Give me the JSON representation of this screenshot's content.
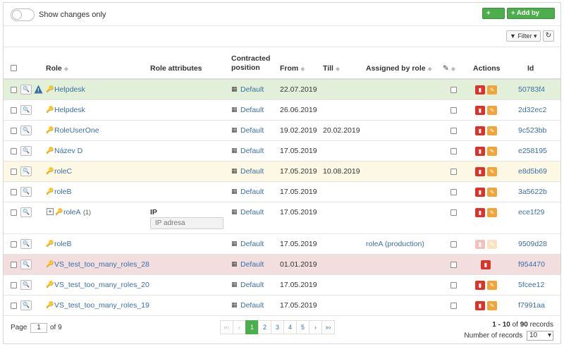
{
  "toolbar": {
    "show_changes_label": "Show changes only",
    "add_label": "+ Add",
    "add_by_user_label": "+ Add by user",
    "filter_label": "Filter",
    "refresh_icon": "↻"
  },
  "columns": {
    "role": "Role",
    "role_attributes": "Role attributes",
    "contracted_position_1": "Contracted",
    "contracted_position_2": "position",
    "from": "From",
    "till": "Till",
    "assigned_by_role": "Assigned by role",
    "actions": "Actions",
    "id": "Id"
  },
  "rows": [
    {
      "role": "Helpdesk",
      "position": "Default",
      "from": "22.07.2019",
      "till": "",
      "assigned_by": "",
      "id": "50783f4"
    },
    {
      "role": "Helpdesk",
      "position": "Default",
      "from": "26.06.2019",
      "till": "",
      "assigned_by": "",
      "id": "2d32ec2"
    },
    {
      "role": "RoleUserOne",
      "position": "Default",
      "from": "19.02.2019",
      "till": "20.02.2019",
      "assigned_by": "",
      "id": "9c523bb"
    },
    {
      "role": "Název D",
      "position": "Default",
      "from": "17.05.2019",
      "till": "",
      "assigned_by": "",
      "id": "e258195"
    },
    {
      "role": "roleC",
      "position": "Default",
      "from": "17.05.2019",
      "till": "10.08.2019",
      "assigned_by": "",
      "id": "e8d5b69"
    },
    {
      "role": "roleB",
      "position": "Default",
      "from": "17.05.2019",
      "till": "",
      "assigned_by": "",
      "id": "3a5622b"
    },
    {
      "role": "roleA",
      "role_count": "(1)",
      "attr_label": "IP",
      "attr_placeholder": "IP adresa",
      "position": "Default",
      "from": "17.05.2019",
      "till": "",
      "assigned_by": "",
      "id": "ece1f29"
    },
    {
      "role": "roleB",
      "position": "Default",
      "from": "17.05.2019",
      "till": "",
      "assigned_by": "roleA (production)",
      "id": "9509d28"
    },
    {
      "role": "VS_test_too_many_roles_28",
      "position": "Default",
      "from": "01.01.2019",
      "till": "",
      "assigned_by": "",
      "id": "f954470"
    },
    {
      "role": "VS_test_too_many_roles_20",
      "position": "Default",
      "from": "17.05.2019",
      "till": "",
      "assigned_by": "",
      "id": "5fcee12"
    },
    {
      "role": "VS_test_too_many_roles_19",
      "position": "Default",
      "from": "17.05.2019",
      "till": "",
      "assigned_by": "",
      "id": "f7991aa"
    }
  ],
  "pagination": {
    "page_label": "Page",
    "current_page": "1",
    "of_label": "of 9",
    "first": "«‹",
    "prev": "‹",
    "pages": [
      "1",
      "2",
      "3",
      "4",
      "5"
    ],
    "next": "›",
    "last": "»›",
    "range": "1 - 10",
    "of_word": "of",
    "total": "90",
    "records_word": "records",
    "number_of_records_label": "Number of records",
    "page_size": "10"
  },
  "colors": {
    "green_row": "#e2f0d9",
    "yellow_row": "#fcf8e3",
    "red_row": "#f2dede",
    "link": "#3a6ea8",
    "accent_green": "#4cae4c"
  }
}
